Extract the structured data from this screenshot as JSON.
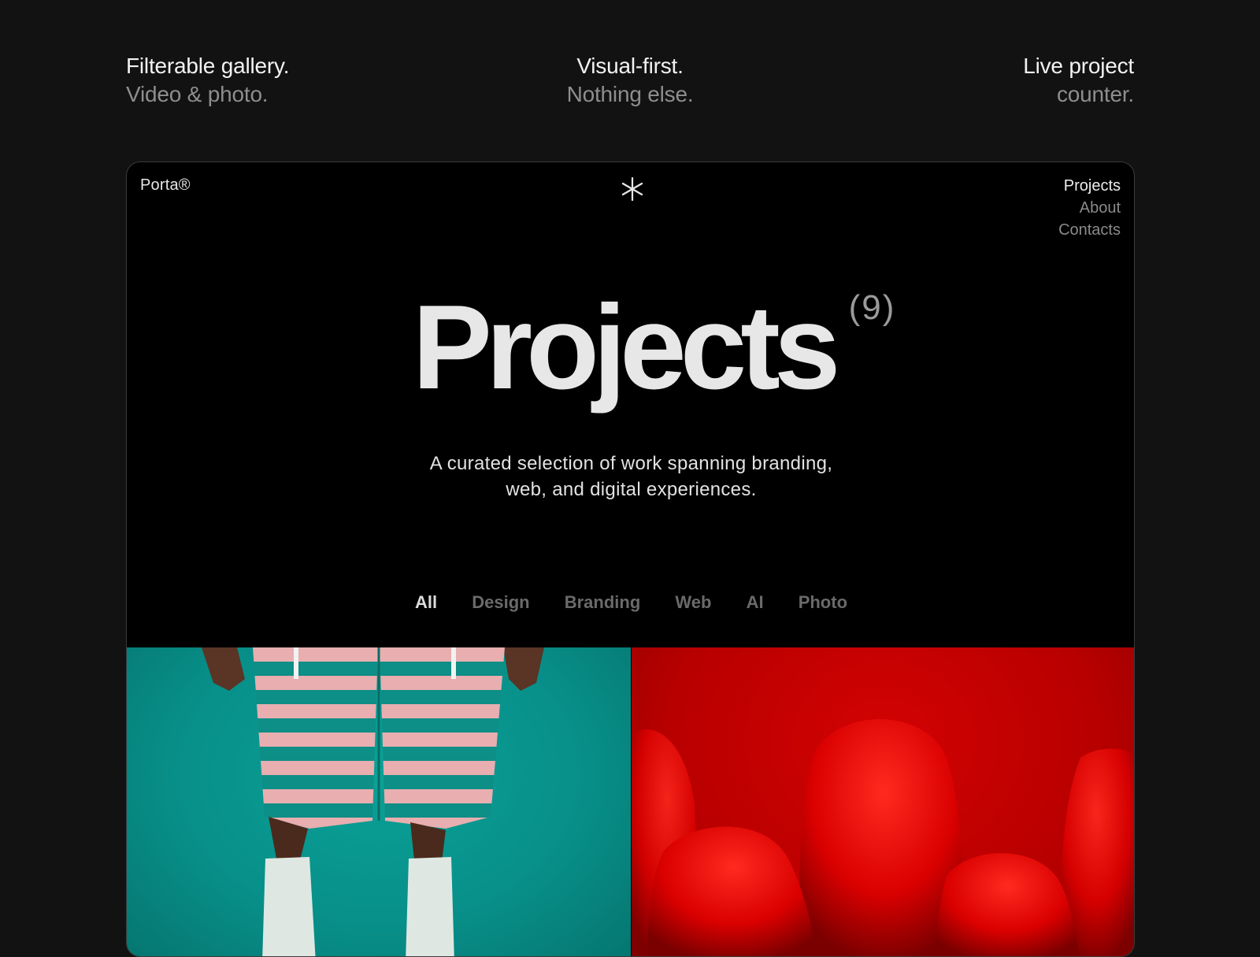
{
  "features": [
    {
      "line1": "Filterable gallery.",
      "line2": "Video & photo."
    },
    {
      "line1": "Visual-first.",
      "line2": "Nothing else."
    },
    {
      "line1": "Live project",
      "line2": "counter."
    }
  ],
  "site": {
    "brand": "Porta®",
    "logo_icon": "asterisk-icon",
    "nav": [
      "Projects",
      "About",
      "Contacts"
    ],
    "nav_active": "Projects"
  },
  "hero": {
    "title": "Projects",
    "count": "(9)",
    "subtitle": "A curated selection of work spanning branding, web, and digital experiences."
  },
  "filters": {
    "items": [
      "All",
      "Design",
      "Branding",
      "Web",
      "AI",
      "Photo"
    ],
    "active": "All"
  },
  "gallery": {
    "tiles": [
      {
        "subject": "striped-shorts-photo",
        "accent": "#0a9a90"
      },
      {
        "subject": "red-veiled-figures-photo",
        "accent": "#c40000"
      }
    ]
  },
  "colors": {
    "page_bg": "#121212",
    "frame_bg": "#000000",
    "text_primary": "#e7e7e7",
    "text_muted": "#8a8a8a"
  }
}
